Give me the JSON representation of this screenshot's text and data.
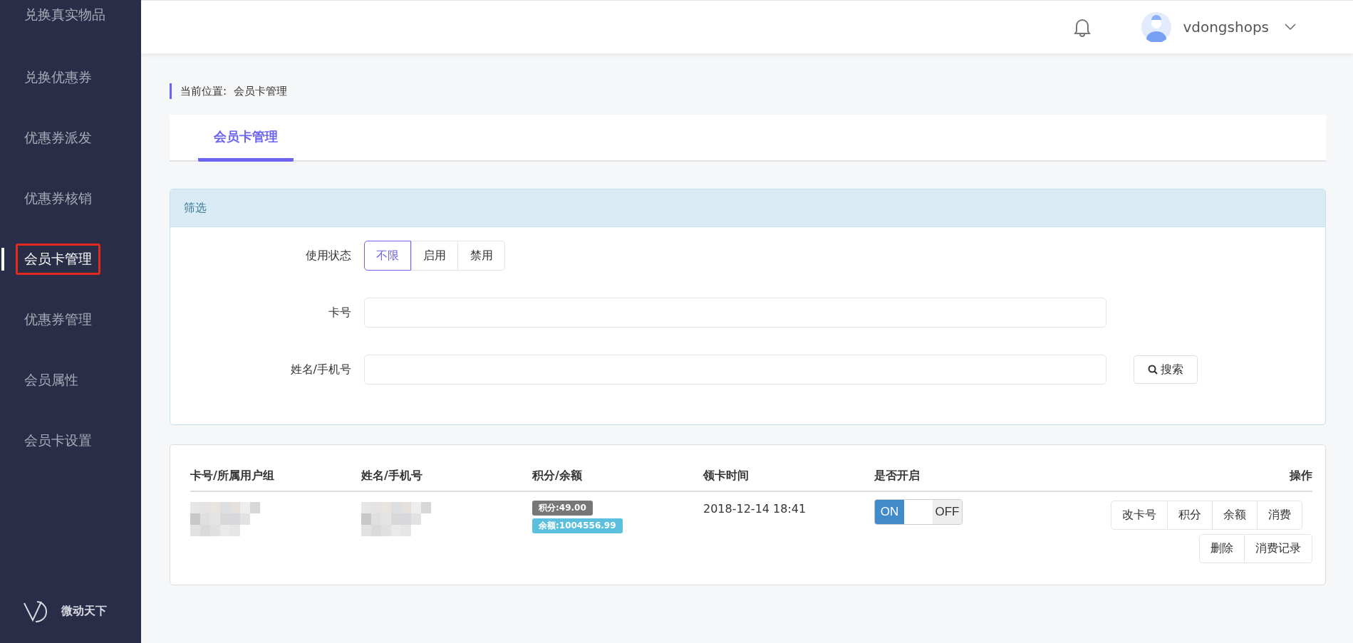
{
  "sidebar": {
    "items": [
      {
        "label": "兑换真实物品",
        "selected": false
      },
      {
        "label": "兑换优惠券",
        "selected": false
      },
      {
        "label": "优惠券派发",
        "selected": false
      },
      {
        "label": "优惠券核销",
        "selected": false
      },
      {
        "label": "会员卡管理",
        "selected": true
      },
      {
        "label": "优惠券管理",
        "selected": false
      },
      {
        "label": "会员属性",
        "selected": false
      },
      {
        "label": "会员卡设置",
        "selected": false
      }
    ],
    "brand": "微动天下"
  },
  "header": {
    "username": "vdongshops"
  },
  "breadcrumb": {
    "label": "当前位置:",
    "current": "会员卡管理"
  },
  "tabs": [
    {
      "label": "会员卡管理",
      "selected": true
    }
  ],
  "filter": {
    "title": "筛选",
    "status": {
      "label": "使用状态",
      "options": [
        {
          "label": "不限",
          "selected": true
        },
        {
          "label": "启用",
          "selected": false
        },
        {
          "label": "禁用",
          "selected": false
        }
      ]
    },
    "card_no": {
      "label": "卡号"
    },
    "name_phone": {
      "label": "姓名/手机号"
    },
    "search_button": "搜索"
  },
  "table": {
    "columns": [
      "卡号/所属用户组",
      "姓名/手机号",
      "积分/余额",
      "领卡时间",
      "是否开启",
      "操作"
    ],
    "rows": [
      {
        "card": {
          "kind": "redacted"
        },
        "name": {
          "kind": "redacted"
        },
        "points": "积分:49.00",
        "balance": "余额:1004556.99",
        "time": "2018-12-14 18:41",
        "toggle": {
          "on": true,
          "on_label": "ON",
          "off_label": "OFF"
        },
        "actions": [
          [
            "改卡号",
            "积分",
            "余额",
            "消费"
          ],
          [
            "删除",
            "消费记录"
          ]
        ]
      }
    ]
  }
}
